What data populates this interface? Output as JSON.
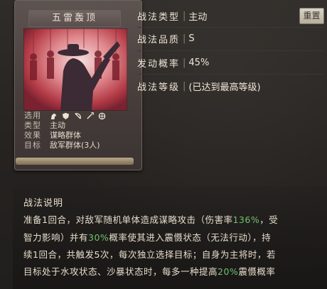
{
  "card": {
    "title": "五雷轰顶",
    "attributes": [
      {
        "key": "选用",
        "value": ""
      },
      {
        "key": "类型",
        "value": "主动"
      },
      {
        "key": "效果",
        "value": "谋略群体"
      },
      {
        "key": "目标",
        "value": "敌军群体(3人)"
      }
    ],
    "troop_icons": [
      "cavalry-icon",
      "shield-icon",
      "bow-icon",
      "spear-icon",
      "wheel-icon"
    ]
  },
  "info": {
    "type_label": "战法类型",
    "type_value": "主动",
    "quality_label": "战法品质",
    "quality_value": "S",
    "rate_label": "发动概率",
    "rate_value": "45%",
    "level_label": "战法等级",
    "level_value": "(已达到最高等级)",
    "reset_label": "重置"
  },
  "description": {
    "title": "战法说明",
    "lines": [
      [
        {
          "t": "准备1回合，对敌军随机单体造成谋略攻击（伤害率"
        },
        {
          "t": "136%",
          "h": true
        },
        {
          "t": "，受"
        }
      ],
      [
        {
          "t": "智力影响）并有"
        },
        {
          "t": "30%",
          "h": true
        },
        {
          "t": "概率使其进入震慑状态（无法行动），持"
        }
      ],
      [
        {
          "t": "续1回合，共触发5次，每次独立选择目标；自身为主将时，若"
        }
      ],
      [
        {
          "t": "目标处于水攻状态、沙暴状态时，每多一种提高"
        },
        {
          "t": "20%",
          "h": true
        },
        {
          "t": "震慑概率"
        }
      ]
    ]
  },
  "colors": {
    "highlight": "#6fc26a",
    "panel_bg": "#2a2725"
  }
}
